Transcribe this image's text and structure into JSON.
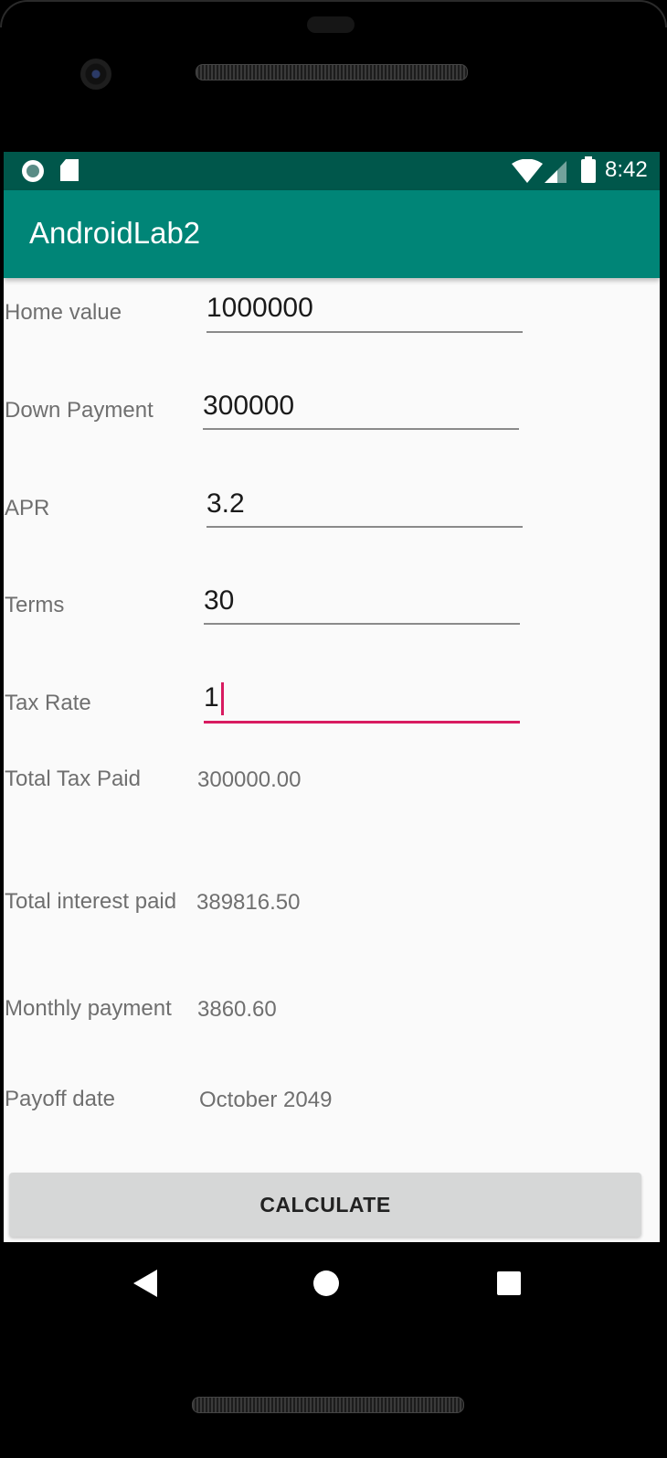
{
  "status_bar": {
    "time": "8:42",
    "icons": [
      "record-icon",
      "sd-card-icon",
      "wifi-icon",
      "cell-signal-icon",
      "battery-icon"
    ]
  },
  "app_bar": {
    "title": "AndroidLab2"
  },
  "form": {
    "home_value": {
      "label": "Home value",
      "value": "1000000"
    },
    "down_payment": {
      "label": "Down Payment",
      "value": "300000"
    },
    "apr": {
      "label": "APR",
      "value": "3.2"
    },
    "terms": {
      "label": "Terms",
      "value": "30"
    },
    "tax_rate": {
      "label": "Tax Rate",
      "value": "1"
    }
  },
  "results": {
    "total_tax_paid": {
      "label": "Total Tax Paid",
      "value": "300000.00"
    },
    "total_interest_paid": {
      "label": "Total interest paid",
      "value": "389816.50"
    },
    "monthly_payment": {
      "label": "Monthly payment",
      "value": "3860.60"
    },
    "payoff_date": {
      "label": "Payoff date",
      "value": "October 2049"
    }
  },
  "actions": {
    "calculate_label": "CALCULATE"
  },
  "colors": {
    "status_bar": "#00574b",
    "app_bar": "#008577",
    "accent": "#d81b60",
    "button": "#d6d7d7"
  }
}
